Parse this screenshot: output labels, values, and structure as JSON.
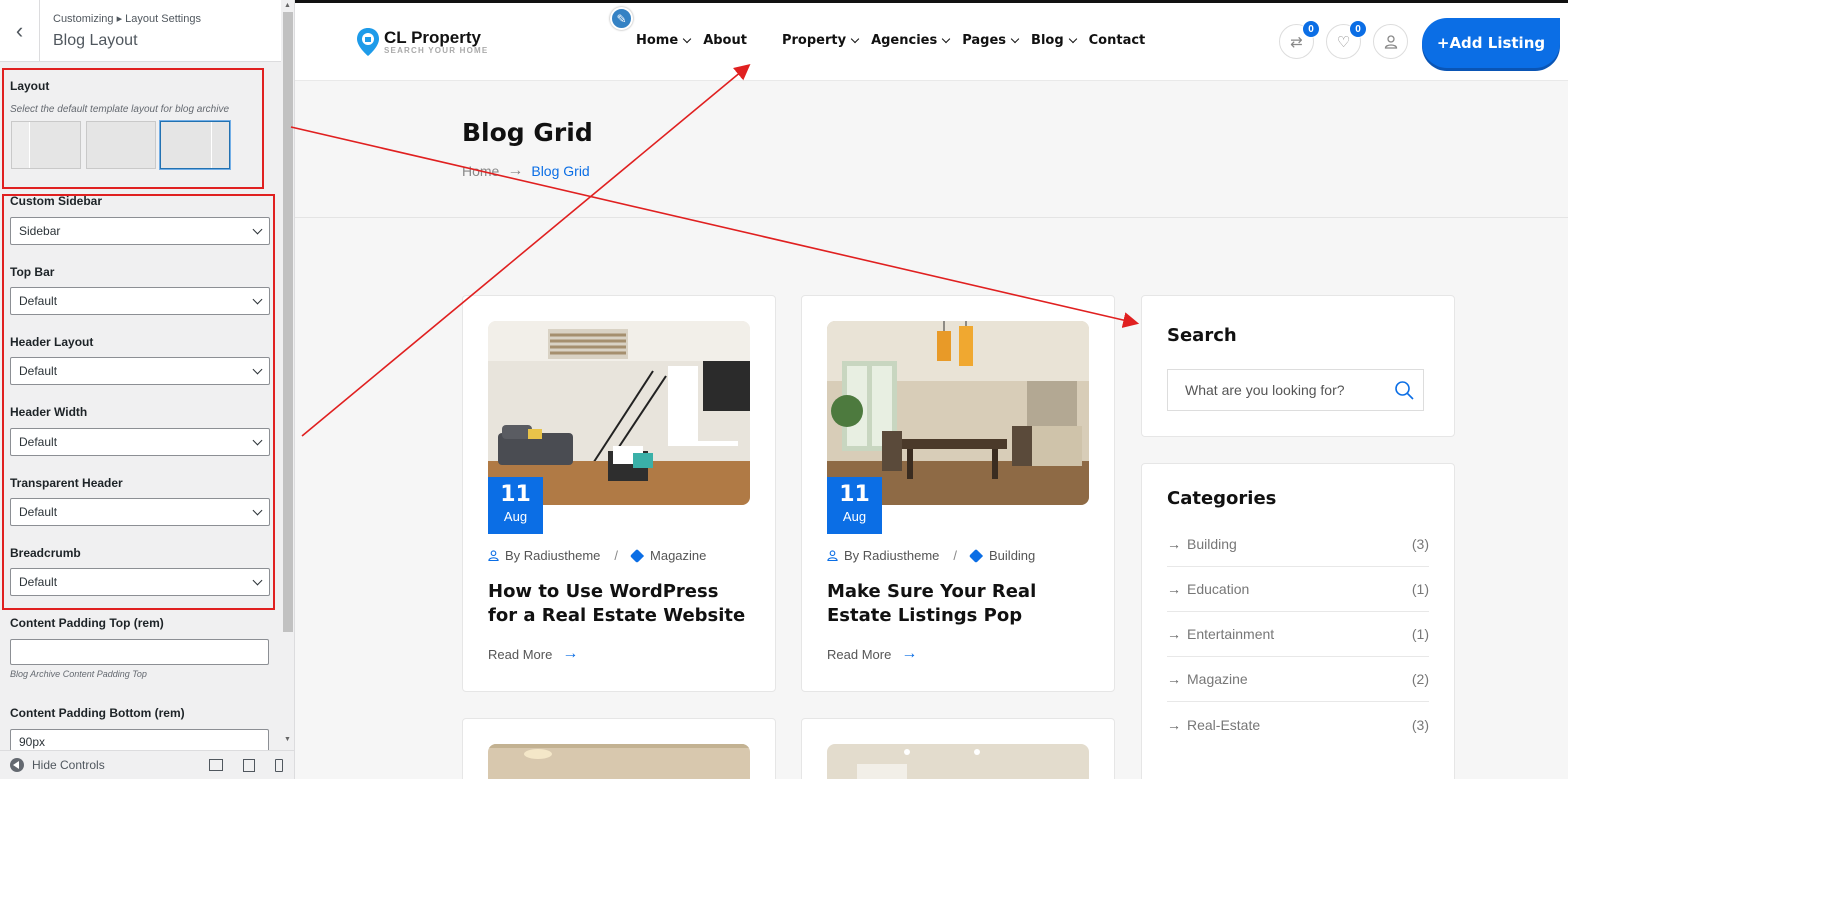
{
  "customizer": {
    "breadcrumb": "Customizing ▸ Layout Settings",
    "title": "Blog Layout",
    "layout": {
      "label": "Layout",
      "description": "Select the default template layout for blog archive",
      "selected_index": 2
    },
    "selects": [
      {
        "label": "Custom Sidebar",
        "value": "Sidebar"
      },
      {
        "label": "Top Bar",
        "value": "Default"
      },
      {
        "label": "Header Layout",
        "value": "Default"
      },
      {
        "label": "Header Width",
        "value": "Default"
      },
      {
        "label": "Transparent Header",
        "value": "Default"
      },
      {
        "label": "Breadcrumb",
        "value": "Default"
      }
    ],
    "padding_top": {
      "label": "Content Padding Top (rem)",
      "value": "",
      "description": "Blog Archive Content Padding Top"
    },
    "padding_bottom": {
      "label": "Content Padding Bottom (rem)",
      "value": "90px"
    },
    "footer": {
      "hide_controls": "Hide Controls"
    }
  },
  "site": {
    "logo": {
      "name": "CL Property",
      "tagline": "SEARCH YOUR HOME"
    },
    "nav": [
      {
        "label": "Home",
        "has_dropdown": true
      },
      {
        "label": "About",
        "has_dropdown": false
      },
      {
        "label": "Property",
        "has_dropdown": true
      },
      {
        "label": "Agencies",
        "has_dropdown": true
      },
      {
        "label": "Pages",
        "has_dropdown": true
      },
      {
        "label": "Blog",
        "has_dropdown": true
      },
      {
        "label": "Contact",
        "has_dropdown": false
      }
    ],
    "compare_count": "0",
    "wishlist_count": "0",
    "add_listing": "Add Listing",
    "page_title": "Blog Grid",
    "breadcrumb": {
      "home": "Home",
      "current": "Blog Grid"
    },
    "posts": [
      {
        "day": "11",
        "month": "Aug",
        "author": "By Radiustheme",
        "category": "Magazine",
        "title": "How to Use WordPress for a Real Estate Website",
        "read_more": "Read More"
      },
      {
        "day": "11",
        "month": "Aug",
        "author": "By Radiustheme",
        "category": "Building",
        "title": "Make Sure Your Real Estate Listings Pop",
        "read_more": "Read More"
      }
    ],
    "search_widget": {
      "title": "Search",
      "placeholder": "What are you looking for?"
    },
    "categories_widget": {
      "title": "Categories",
      "items": [
        {
          "name": "Building",
          "count": "(3)"
        },
        {
          "name": "Education",
          "count": "(1)"
        },
        {
          "name": "Entertainment",
          "count": "(1)"
        },
        {
          "name": "Magazine",
          "count": "(2)"
        },
        {
          "name": "Real-Estate",
          "count": "(3)"
        }
      ]
    }
  },
  "colors": {
    "accent": "#0b6ee5",
    "annotation": "#e02020"
  }
}
